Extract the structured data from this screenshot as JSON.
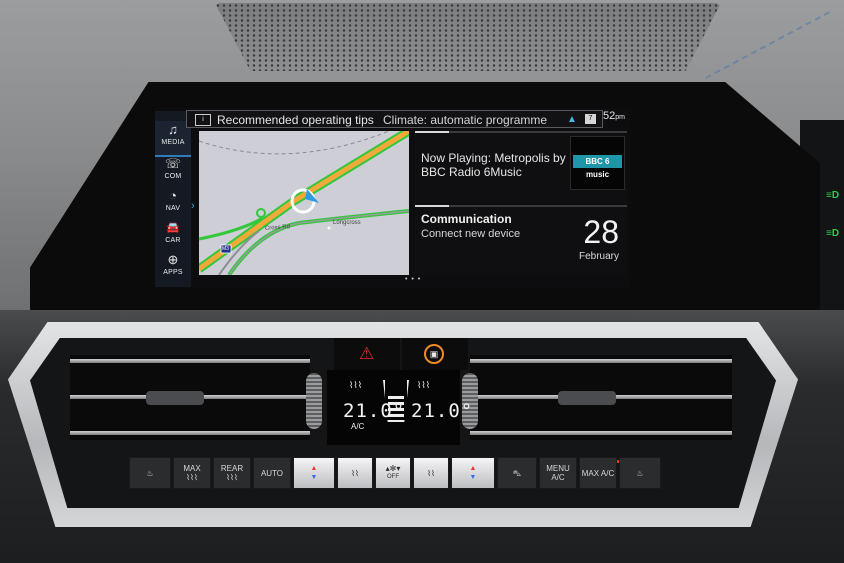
{
  "screen": {
    "tips_bar": {
      "book_icon": "book-icon",
      "title": "Recommended operating tips",
      "message": "Climate: automatic programme",
      "expand_icon": "chevron-up-icon",
      "count": "7"
    },
    "clock": {
      "time": "52",
      "suffix": "pm"
    },
    "sidebar": {
      "items": [
        {
          "label": "MEDIA",
          "icon": "music-note-icon",
          "glyph": "♫",
          "active": true
        },
        {
          "label": "COM",
          "icon": "phone-screen-icon",
          "glyph": "☏",
          "active": false
        },
        {
          "label": "NAV",
          "icon": "navigation-icon",
          "glyph": "◔",
          "active": false
        },
        {
          "label": "CAR",
          "icon": "car-icon",
          "glyph": "🚘",
          "active": false
        },
        {
          "label": "APPS",
          "icon": "globe-icon",
          "glyph": "⊕",
          "active": false
        }
      ],
      "expand_glyph": "›"
    },
    "map": {
      "road_labels": [
        "Cross Rd",
        "Longcross"
      ],
      "motorway_sign": "M3",
      "pager": "• • •"
    },
    "now_playing": {
      "text": "Now Playing: Metropolis by BBC Radio 6Music",
      "station_logo": "BBC 6 music"
    },
    "communication": {
      "title": "Communication",
      "subtitle": "Connect new device",
      "date_day": "28",
      "date_month": "February"
    }
  },
  "console": {
    "hazard_glyph": "⚠",
    "lock_glyph": "🔒",
    "climate_display": {
      "left_temp": "21.0°",
      "right_temp": "21.0°",
      "ac_label": "A/C",
      "fan_level_fraction": 0.5
    },
    "buttons": [
      {
        "id": "seat-heat-left",
        "label": "",
        "glyph": "♨"
      },
      {
        "id": "max-defrost",
        "label": "MAX",
        "glyph": "⌇⌇⌇"
      },
      {
        "id": "rear-defrost",
        "label": "REAR",
        "glyph": "⌇⌇⌇"
      },
      {
        "id": "auto",
        "label": "AUTO",
        "glyph": ""
      },
      {
        "id": "temp-left",
        "label": "",
        "glyph": ""
      },
      {
        "id": "airflow-left",
        "label": "",
        "glyph": "⌇⌇"
      },
      {
        "id": "fan-speed",
        "label": "OFF",
        "glyph": "▴✻▾"
      },
      {
        "id": "airflow-right",
        "label": "",
        "glyph": "⌇⌇"
      },
      {
        "id": "temp-right",
        "label": "",
        "glyph": ""
      },
      {
        "id": "recirculation",
        "label": "",
        "glyph": "⛍"
      },
      {
        "id": "menu-ac",
        "label": "MENU A/C",
        "glyph": ""
      },
      {
        "id": "max-ac",
        "label": "MAX A/C",
        "glyph": ""
      },
      {
        "id": "seat-heat-right",
        "label": "",
        "glyph": "♨"
      }
    ]
  }
}
